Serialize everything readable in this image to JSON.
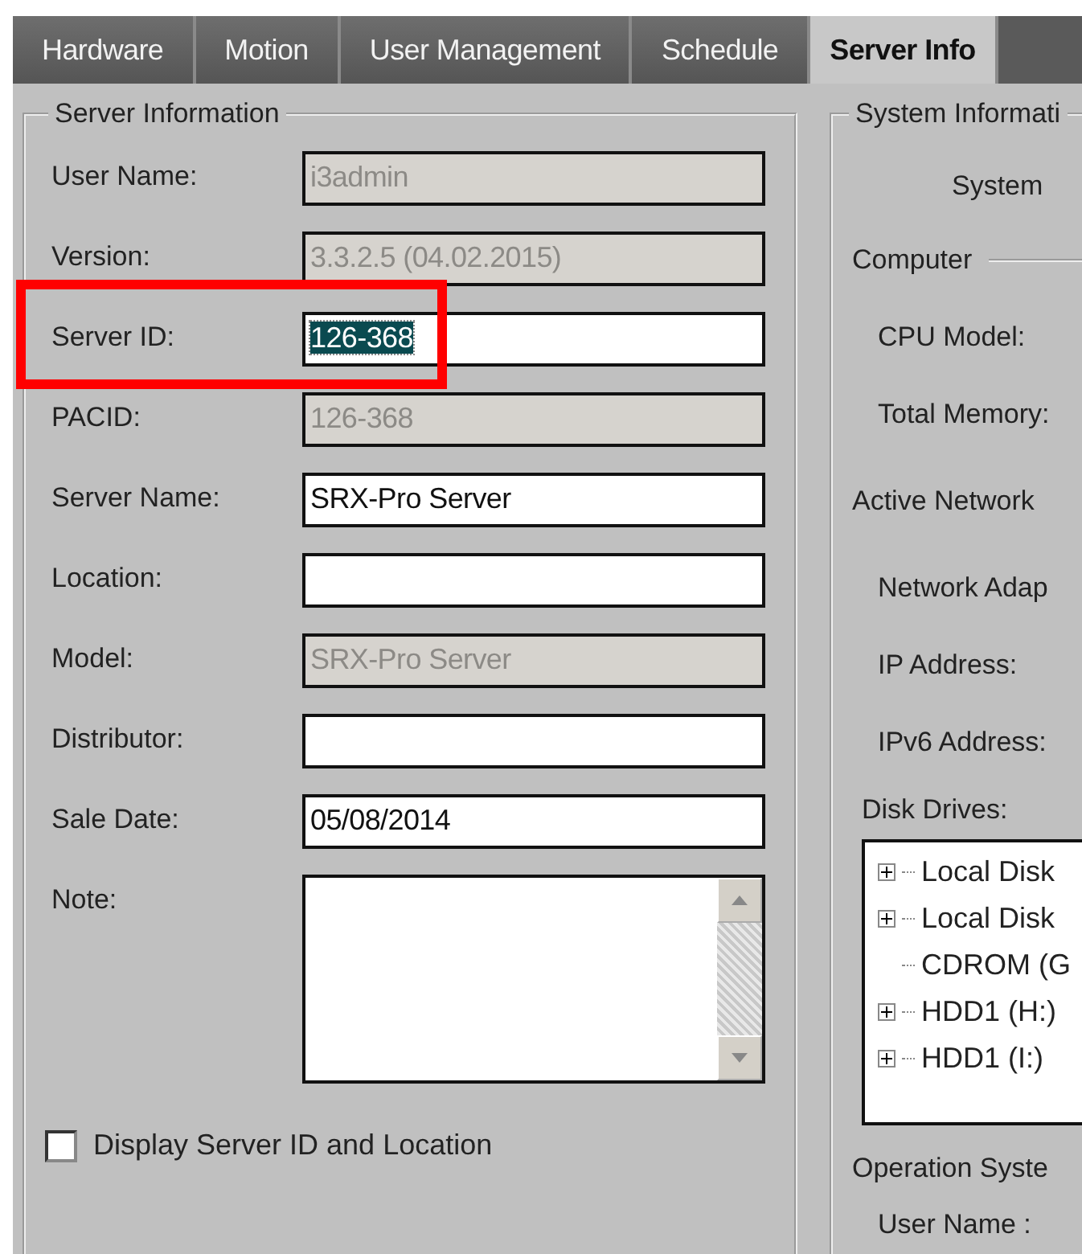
{
  "tabs": [
    {
      "label": "Hardware",
      "selected": false
    },
    {
      "label": "Motion",
      "selected": false
    },
    {
      "label": "User Management",
      "selected": false
    },
    {
      "label": "Schedule",
      "selected": false
    },
    {
      "label": "Server Info",
      "selected": true
    }
  ],
  "server_information": {
    "title": "Server Information",
    "fields": [
      {
        "label": "User Name:",
        "kind": "text",
        "value": "i3admin",
        "disabled": true
      },
      {
        "label": "Version:",
        "kind": "text",
        "value": "3.3.2.5  (04.02.2015)",
        "disabled": true
      },
      {
        "label": "Server ID:",
        "kind": "text",
        "value": "126-368",
        "disabled": false,
        "highlighted": true,
        "text_selected": true
      },
      {
        "label": "PACID:",
        "kind": "text",
        "value": "126-368",
        "disabled": true
      },
      {
        "label": "Server Name:",
        "kind": "text",
        "value": "SRX-Pro Server",
        "disabled": false
      },
      {
        "label": "Location:",
        "kind": "text",
        "disabled": false
      },
      {
        "label": "Model:",
        "kind": "text",
        "value": "SRX-Pro Server",
        "disabled": true
      },
      {
        "label": "Distributor:",
        "kind": "text",
        "disabled": false
      },
      {
        "label": "Sale Date:",
        "kind": "text",
        "value": "05/08/2014",
        "disabled": false
      },
      {
        "label": "Note:",
        "kind": "textarea",
        "disabled": false
      }
    ],
    "checkbox": {
      "label": "Display Server ID and Location",
      "checked": false
    }
  },
  "system_information": {
    "title": "System Informati",
    "items": [
      {
        "kind": "caption",
        "text": "System"
      },
      {
        "kind": "section",
        "text": "Computer"
      },
      {
        "kind": "label",
        "text": "CPU Model:"
      },
      {
        "kind": "label",
        "text": "Total Memory:"
      },
      {
        "kind": "heading",
        "text": "Active Network"
      },
      {
        "kind": "label",
        "text": "Network Adap"
      },
      {
        "kind": "label",
        "text": "IP Address:"
      },
      {
        "kind": "label",
        "text": "IPv6 Address:"
      }
    ],
    "disk_drives": {
      "label": "Disk Drives:",
      "items": [
        {
          "text": "Local Disk",
          "expandable": true
        },
        {
          "text": "Local Disk",
          "expandable": true
        },
        {
          "text": "CDROM (G",
          "expandable": false
        },
        {
          "text": "HDD1 (H:)",
          "expandable": true
        },
        {
          "text": "HDD1 (I:)",
          "expandable": true
        }
      ]
    },
    "after": [
      {
        "kind": "heading",
        "text": "Operation Syste"
      },
      {
        "kind": "label",
        "text": "User Name :"
      }
    ]
  }
}
